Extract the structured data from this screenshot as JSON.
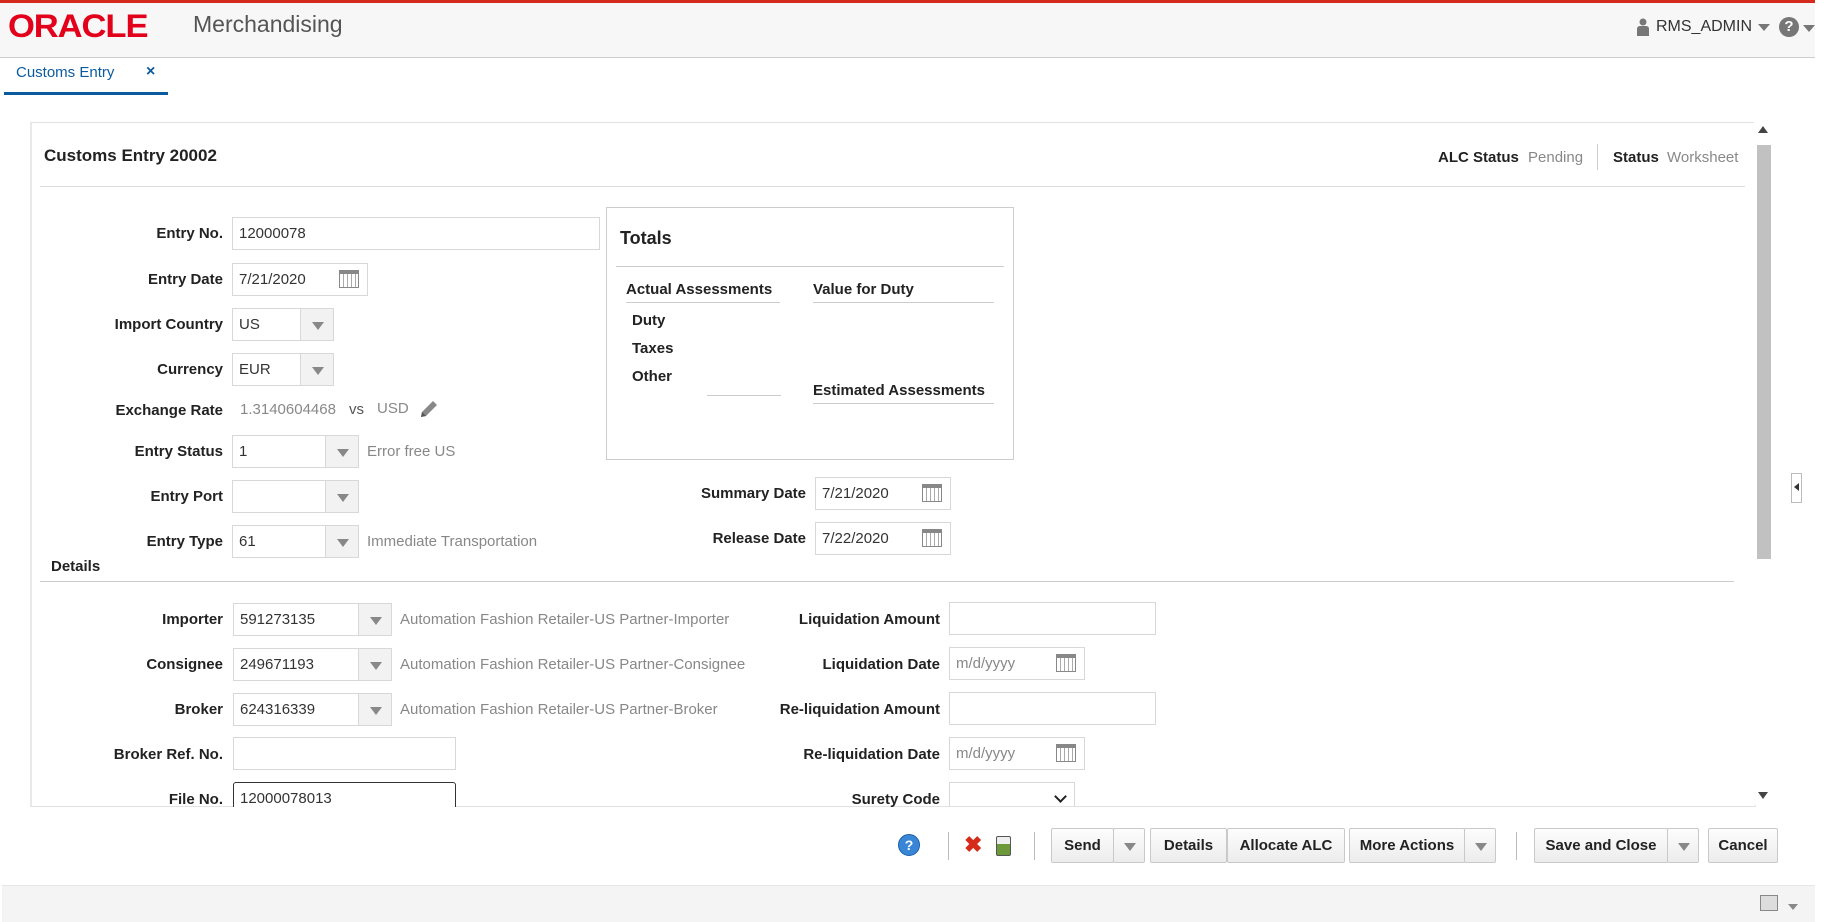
{
  "app": {
    "brand": "ORACLE",
    "product": "Merchandising",
    "user": "RMS_ADMIN",
    "help_glyph": "?"
  },
  "tabs": [
    {
      "label": "Customs Entry",
      "close_glyph": "×"
    }
  ],
  "page": {
    "title": "Customs Entry 20002",
    "alc_status_label": "ALC Status",
    "alc_status_value": "Pending",
    "status_label": "Status",
    "status_value": "Worksheet"
  },
  "form": {
    "entry_no": {
      "label": "Entry No.",
      "value": "12000078"
    },
    "entry_date": {
      "label": "Entry Date",
      "value": "7/21/2020"
    },
    "import_country": {
      "label": "Import Country",
      "value": "US"
    },
    "currency": {
      "label": "Currency",
      "value": "EUR"
    },
    "exchange_rate": {
      "label": "Exchange Rate",
      "value": "1.3140604468",
      "vs": "vs",
      "currency": "USD"
    },
    "entry_status": {
      "label": "Entry Status",
      "value": "1",
      "desc": "Error free US"
    },
    "entry_port": {
      "label": "Entry Port",
      "value": ""
    },
    "entry_type": {
      "label": "Entry Type",
      "value": "61",
      "desc": "Immediate Transportation"
    },
    "summary_date": {
      "label": "Summary Date",
      "value": "7/21/2020"
    },
    "release_date": {
      "label": "Release Date",
      "value": "7/22/2020"
    }
  },
  "totals": {
    "title": "Totals",
    "actual_header": "Actual Assessments",
    "vfd_header": "Value for Duty",
    "rows": [
      "Duty",
      "Taxes",
      "Other"
    ],
    "estimated_header": "Estimated Assessments"
  },
  "details": {
    "header": "Details",
    "importer": {
      "label": "Importer",
      "value": "591273135",
      "desc": "Automation Fashion Retailer-US Partner-Importer"
    },
    "consignee": {
      "label": "Consignee",
      "value": "249671193",
      "desc": "Automation Fashion Retailer-US Partner-Consignee"
    },
    "broker": {
      "label": "Broker",
      "value": "624316339",
      "desc": "Automation Fashion Retailer-US Partner-Broker"
    },
    "broker_ref": {
      "label": "Broker Ref. No.",
      "value": ""
    },
    "file_no": {
      "label": "File No.",
      "value": "12000078013"
    },
    "liquidation_amount": {
      "label": "Liquidation Amount",
      "value": ""
    },
    "liquidation_date": {
      "label": "Liquidation Date",
      "placeholder": "m/d/yyyy"
    },
    "reliquidation_amount": {
      "label": "Re-liquidation Amount",
      "value": ""
    },
    "reliquidation_date": {
      "label": "Re-liquidation Date",
      "placeholder": "m/d/yyyy"
    },
    "surety_code": {
      "label": "Surety Code",
      "value": ""
    }
  },
  "toolbar": {
    "help_glyph": "?",
    "delete_glyph": "✖",
    "send": "Send",
    "details": "Details",
    "allocate_alc": "Allocate ALC",
    "more_actions": "More Actions",
    "save_and_close": "Save and Close",
    "cancel": "Cancel"
  },
  "icons": [
    "user-icon",
    "help-icon",
    "calendar-icon",
    "pencil-icon",
    "dropdown-arrow-icon",
    "delete-icon",
    "calculator-icon"
  ],
  "colors": {
    "brand_red": "#e3001b",
    "link_blue": "#0b5a9e",
    "delete_red": "#d62b1b"
  }
}
